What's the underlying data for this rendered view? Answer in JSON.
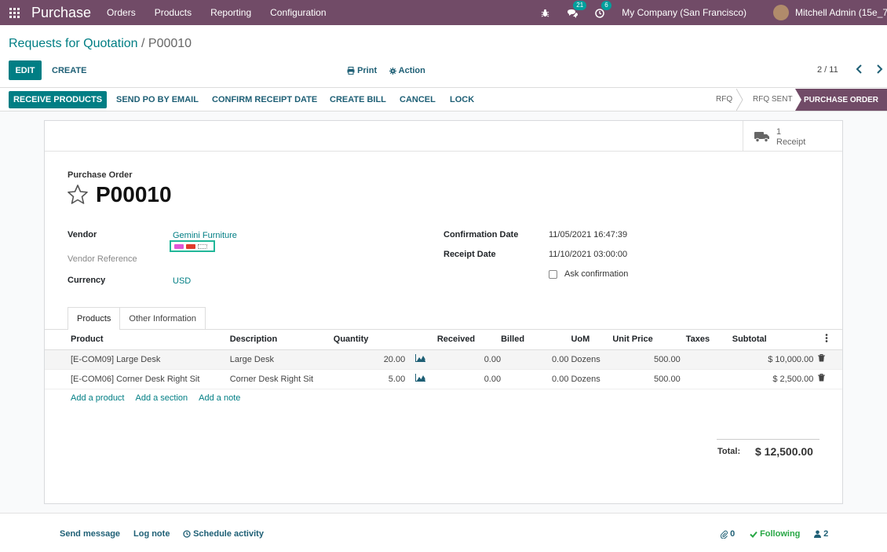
{
  "navbar": {
    "app_name": "Purchase",
    "menus": [
      "Orders",
      "Products",
      "Reporting",
      "Configuration"
    ],
    "messages_count": "21",
    "activities_count": "6",
    "company": "My Company (San Francisco)",
    "user": "Mitchell Admin (15e_7"
  },
  "breadcrumb": {
    "parent": "Requests for Quotation",
    "separator": "/",
    "current": "P00010"
  },
  "control": {
    "edit": "EDIT",
    "create": "CREATE",
    "print": "Print",
    "action": "Action",
    "pager": "2 / 11"
  },
  "statusbar": {
    "receive": "RECEIVE PRODUCTS",
    "send_email": "SEND PO BY EMAIL",
    "confirm_receipt": "CONFIRM RECEIPT DATE",
    "create_bill": "CREATE BILL",
    "cancel": "CANCEL",
    "lock": "LOCK",
    "stages": [
      "RFQ",
      "RFQ SENT",
      "PURCHASE ORDER"
    ],
    "active_stage": "PURCHASE ORDER"
  },
  "smart_button": {
    "count": "1",
    "label": "Receipt"
  },
  "form": {
    "title_label": "Purchase Order",
    "name": "P00010",
    "vendor_label": "Vendor",
    "vendor": "Gemini Furniture",
    "vendor_ref_label": "Vendor Reference",
    "currency_label": "Currency",
    "currency": "USD",
    "confirmation_label": "Confirmation Date",
    "confirmation_date": "11/05/2021 16:47:39",
    "receipt_label": "Receipt Date",
    "receipt_date": "11/10/2021 03:00:00",
    "ask_confirmation": "Ask confirmation",
    "tag_colors": [
      "#e255d6",
      "#e23a2b",
      "#ffffff"
    ]
  },
  "tabs": [
    "Products",
    "Other Information"
  ],
  "table": {
    "headers": {
      "product": "Product",
      "description": "Description",
      "quantity": "Quantity",
      "received": "Received",
      "billed": "Billed",
      "uom": "UoM",
      "unit_price": "Unit Price",
      "taxes": "Taxes",
      "subtotal": "Subtotal"
    },
    "rows": [
      {
        "product": "[E-COM09] Large Desk",
        "description": "Large Desk",
        "quantity": "20.00",
        "received": "0.00",
        "billed": "0.00",
        "uom": "Dozens",
        "unit_price": "500.00",
        "taxes": "",
        "subtotal": "$ 10,000.00"
      },
      {
        "product": "[E-COM06] Corner Desk Right Sit",
        "description": "Corner Desk Right Sit",
        "quantity": "5.00",
        "received": "0.00",
        "billed": "0.00",
        "uom": "Dozens",
        "unit_price": "500.00",
        "taxes": "",
        "subtotal": "$ 2,500.00"
      }
    ],
    "add_product": "Add a product",
    "add_section": "Add a section",
    "add_note": "Add a note"
  },
  "totals": {
    "label": "Total:",
    "value": "$ 12,500.00"
  },
  "chatter": {
    "send_message": "Send message",
    "log_note": "Log note",
    "schedule_activity": "Schedule activity",
    "attachments": "0",
    "following": "Following",
    "followers": "2"
  },
  "colors": {
    "brand": "#714B67",
    "primary": "#017E84",
    "link": "#1E5F75"
  }
}
